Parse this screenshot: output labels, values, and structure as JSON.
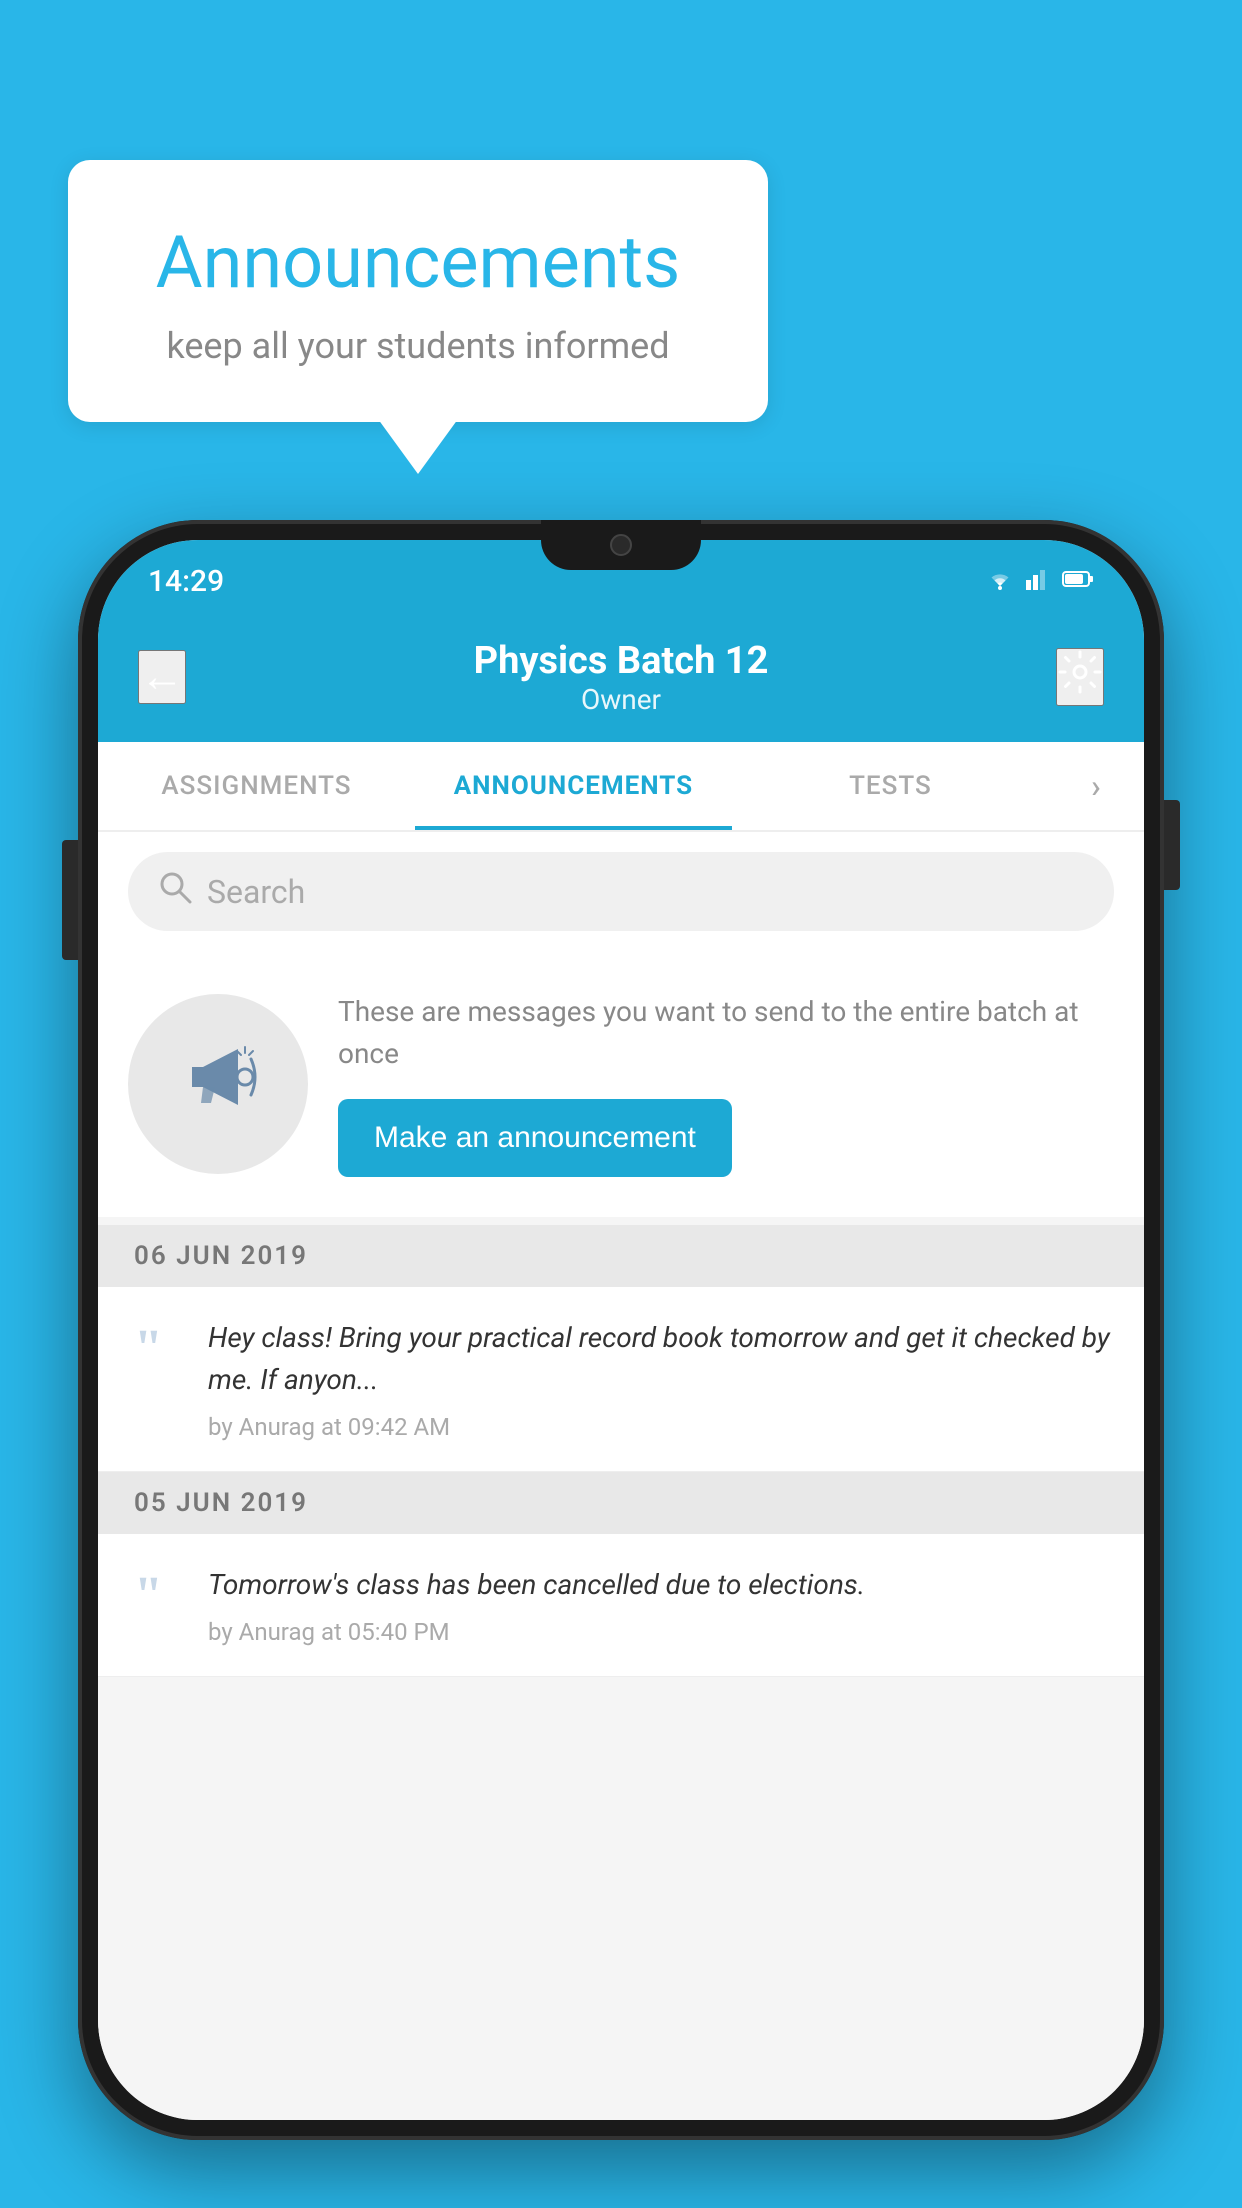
{
  "page": {
    "background_color": "#29B6E8"
  },
  "speech_bubble": {
    "title": "Announcements",
    "subtitle": "keep all your students informed"
  },
  "status_bar": {
    "time": "14:29",
    "wifi": "▼",
    "signal": "▲",
    "battery": "▓"
  },
  "header": {
    "back_label": "←",
    "title": "Physics Batch 12",
    "subtitle": "Owner",
    "settings_label": "⚙"
  },
  "tabs": [
    {
      "label": "ASSIGNMENTS",
      "active": false
    },
    {
      "label": "ANNOUNCEMENTS",
      "active": true
    },
    {
      "label": "TESTS",
      "active": false
    },
    {
      "label": "›",
      "active": false
    }
  ],
  "search": {
    "placeholder": "Search"
  },
  "promo": {
    "description": "These are messages you want to\nsend to the entire batch at once",
    "button_label": "Make an announcement"
  },
  "announcements": [
    {
      "date": "06  JUN  2019",
      "items": [
        {
          "text": "Hey class! Bring your practical record book tomorrow and get it checked by me. If anyon...",
          "meta": "by Anurag at 09:42 AM"
        }
      ]
    },
    {
      "date": "05  JUN  2019",
      "items": [
        {
          "text": "Tomorrow's class has been cancelled due to elections.",
          "meta": "by Anurag at 05:40 PM"
        }
      ]
    }
  ]
}
